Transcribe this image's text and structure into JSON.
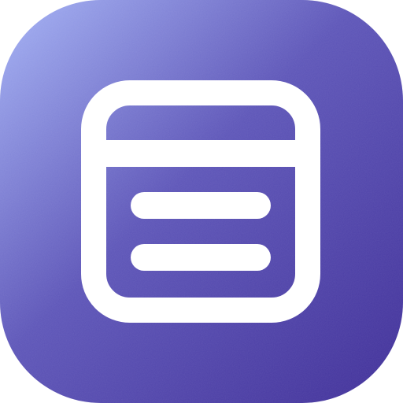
{
  "icon": {
    "glyph": "window-list-icon",
    "colors": {
      "gradient_start": "#a4b2f5",
      "gradient_mid": "#5d55b8",
      "gradient_end": "#3f2e98",
      "glyph": "#ffffff"
    }
  }
}
